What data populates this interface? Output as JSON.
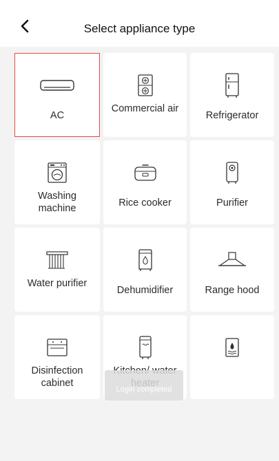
{
  "header": {
    "title": "Select appliance type",
    "back_icon": "chevron-left-icon"
  },
  "appliances": [
    {
      "label": "AC",
      "icon": "air-conditioner-icon",
      "selected": true
    },
    {
      "label": "Commercial air",
      "icon": "commercial-air-icon"
    },
    {
      "label": "Refrigerator",
      "icon": "refrigerator-icon"
    },
    {
      "label": "Washing machine",
      "icon": "washing-machine-icon"
    },
    {
      "label": "Rice cooker",
      "icon": "rice-cooker-icon"
    },
    {
      "label": "Purifier",
      "icon": "purifier-icon"
    },
    {
      "label": "Water purifier",
      "icon": "water-purifier-icon"
    },
    {
      "label": "Dehumidifier",
      "icon": "dehumidifier-icon"
    },
    {
      "label": "Range hood",
      "icon": "range-hood-icon"
    },
    {
      "label": "Disinfection cabinet",
      "icon": "disinfection-cabinet-icon"
    },
    {
      "label": "Kitchen/ water heater",
      "icon": "water-heater-icon"
    },
    {
      "label": "",
      "icon": "water-dispenser-icon"
    }
  ],
  "toast": {
    "text": "Login completed"
  },
  "colors": {
    "selected_border": "#e34a3f",
    "background": "#f3f3f3",
    "tile": "#ffffff"
  }
}
